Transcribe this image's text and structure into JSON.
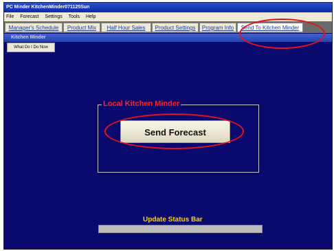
{
  "window": {
    "title": "PC Minder  KitchenMinder071125Sun"
  },
  "menu": [
    "File",
    "Forecast",
    "Settings",
    "Tools",
    "Help"
  ],
  "tabs": [
    {
      "label": "Manager's Schedule",
      "active": false
    },
    {
      "label": "Product Mix",
      "active": false
    },
    {
      "label": "Half Hour Sales",
      "active": false
    },
    {
      "label": "Product Settings",
      "active": false
    },
    {
      "label": "Program Info",
      "active": false
    },
    {
      "label": "Send To Kitchen Minder",
      "active": true
    }
  ],
  "panel": {
    "title": "Kitchen Minder",
    "help_button": "What Do I Do Now",
    "group_label": "Local Kitchen Minder",
    "send_button": "Send Forecast",
    "status_label": "Update Status Bar",
    "status_progress": 0
  },
  "colors": {
    "background": "#0a0a6e",
    "accent_red": "#e5121e",
    "status_yellow": "#ffd200"
  }
}
